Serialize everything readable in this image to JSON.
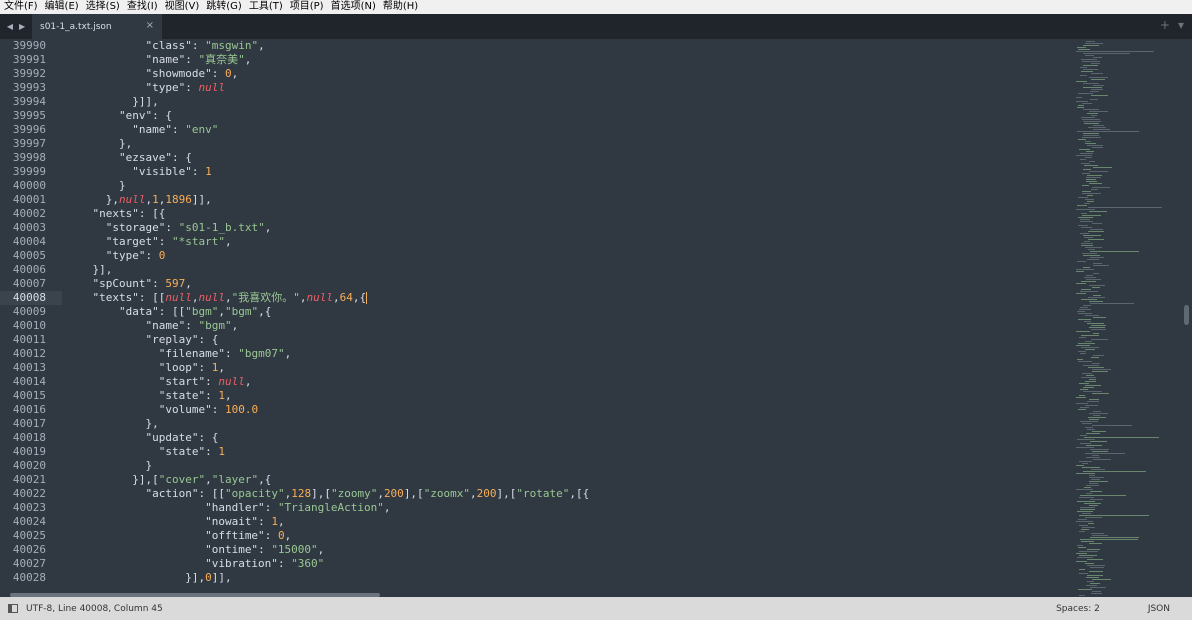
{
  "menu": [
    "文件(F)",
    "编辑(E)",
    "选择(S)",
    "查找(I)",
    "视图(V)",
    "跳转(G)",
    "工具(T)",
    "项目(P)",
    "首选项(N)",
    "帮助(H)"
  ],
  "tab": {
    "title": "s01-1_a.txt.json",
    "close": "×"
  },
  "tab_actions": {
    "add": "+",
    "menu": "▾"
  },
  "nav": {
    "back": "◀",
    "forward": "▶"
  },
  "editor": {
    "active_line": 40008,
    "lines": [
      {
        "n": "39990",
        "t": [
          [
            "p",
            "            "
          ],
          [
            "k",
            "\"class\""
          ],
          [
            "p",
            ": "
          ],
          [
            "s",
            "\"msgwin\""
          ],
          [
            "p",
            ","
          ]
        ]
      },
      {
        "n": "39991",
        "t": [
          [
            "p",
            "            "
          ],
          [
            "k",
            "\"name\""
          ],
          [
            "p",
            ": "
          ],
          [
            "s",
            "\"真奈美\""
          ],
          [
            "p",
            ","
          ]
        ]
      },
      {
        "n": "39992",
        "t": [
          [
            "p",
            "            "
          ],
          [
            "k",
            "\"showmode\""
          ],
          [
            "p",
            ": "
          ],
          [
            "n",
            "0"
          ],
          [
            "p",
            ","
          ]
        ]
      },
      {
        "n": "39993",
        "t": [
          [
            "p",
            "            "
          ],
          [
            "k",
            "\"type\""
          ],
          [
            "p",
            ": "
          ],
          [
            "nl",
            "null"
          ]
        ]
      },
      {
        "n": "39994",
        "t": [
          [
            "p",
            "          }]],"
          ]
        ]
      },
      {
        "n": "39995",
        "t": [
          [
            "p",
            "        "
          ],
          [
            "k",
            "\"env\""
          ],
          [
            "p",
            ": {"
          ]
        ]
      },
      {
        "n": "39996",
        "t": [
          [
            "p",
            "          "
          ],
          [
            "k",
            "\"name\""
          ],
          [
            "p",
            ": "
          ],
          [
            "s",
            "\"env\""
          ]
        ]
      },
      {
        "n": "39997",
        "t": [
          [
            "p",
            "        },"
          ]
        ]
      },
      {
        "n": "39998",
        "t": [
          [
            "p",
            "        "
          ],
          [
            "k",
            "\"ezsave\""
          ],
          [
            "p",
            ": {"
          ]
        ]
      },
      {
        "n": "39999",
        "t": [
          [
            "p",
            "          "
          ],
          [
            "k",
            "\"visible\""
          ],
          [
            "p",
            ": "
          ],
          [
            "n",
            "1"
          ]
        ]
      },
      {
        "n": "40000",
        "t": [
          [
            "p",
            "        }"
          ]
        ]
      },
      {
        "n": "40001",
        "t": [
          [
            "p",
            "      },"
          ],
          [
            "nl",
            "null"
          ],
          [
            "p",
            ","
          ],
          [
            "n",
            "1"
          ],
          [
            "p",
            ","
          ],
          [
            "n",
            "1896"
          ],
          [
            "p",
            "]],"
          ]
        ]
      },
      {
        "n": "40002",
        "t": [
          [
            "p",
            "    "
          ],
          [
            "k",
            "\"nexts\""
          ],
          [
            "p",
            ": [{"
          ]
        ]
      },
      {
        "n": "40003",
        "t": [
          [
            "p",
            "      "
          ],
          [
            "k",
            "\"storage\""
          ],
          [
            "p",
            ": "
          ],
          [
            "s",
            "\"s01-1_b.txt\""
          ],
          [
            "p",
            ","
          ]
        ]
      },
      {
        "n": "40004",
        "t": [
          [
            "p",
            "      "
          ],
          [
            "k",
            "\"target\""
          ],
          [
            "p",
            ": "
          ],
          [
            "s",
            "\"*start\""
          ],
          [
            "p",
            ","
          ]
        ]
      },
      {
        "n": "40005",
        "t": [
          [
            "p",
            "      "
          ],
          [
            "k",
            "\"type\""
          ],
          [
            "p",
            ": "
          ],
          [
            "n",
            "0"
          ]
        ]
      },
      {
        "n": "40006",
        "t": [
          [
            "p",
            "    }],"
          ]
        ]
      },
      {
        "n": "40007",
        "t": [
          [
            "p",
            "    "
          ],
          [
            "k",
            "\"spCount\""
          ],
          [
            "p",
            ": "
          ],
          [
            "n",
            "597"
          ],
          [
            "p",
            ","
          ]
        ]
      },
      {
        "n": "40008",
        "t": [
          [
            "p",
            "    "
          ],
          [
            "k",
            "\"texts\""
          ],
          [
            "p",
            ": [["
          ],
          [
            "nl",
            "null"
          ],
          [
            "p",
            ","
          ],
          [
            "nl",
            "null"
          ],
          [
            "p",
            ","
          ],
          [
            "s",
            "\"我喜欢你。\""
          ],
          [
            "p",
            ","
          ],
          [
            "nl",
            "null"
          ],
          [
            "p",
            ","
          ],
          [
            "n",
            "64"
          ],
          [
            "p",
            ",{"
          ]
        ],
        "cursor": true
      },
      {
        "n": "40009",
        "t": [
          [
            "p",
            "        "
          ],
          [
            "k",
            "\"data\""
          ],
          [
            "p",
            ": [["
          ],
          [
            "s",
            "\"bgm\""
          ],
          [
            "p",
            ","
          ],
          [
            "s",
            "\"bgm\""
          ],
          [
            "p",
            ",{"
          ]
        ]
      },
      {
        "n": "40010",
        "t": [
          [
            "p",
            "            "
          ],
          [
            "k",
            "\"name\""
          ],
          [
            "p",
            ": "
          ],
          [
            "s",
            "\"bgm\""
          ],
          [
            "p",
            ","
          ]
        ]
      },
      {
        "n": "40011",
        "t": [
          [
            "p",
            "            "
          ],
          [
            "k",
            "\"replay\""
          ],
          [
            "p",
            ": {"
          ]
        ]
      },
      {
        "n": "40012",
        "t": [
          [
            "p",
            "              "
          ],
          [
            "k",
            "\"filename\""
          ],
          [
            "p",
            ": "
          ],
          [
            "s",
            "\"bgm07\""
          ],
          [
            "p",
            ","
          ]
        ]
      },
      {
        "n": "40013",
        "t": [
          [
            "p",
            "              "
          ],
          [
            "k",
            "\"loop\""
          ],
          [
            "p",
            ": "
          ],
          [
            "n",
            "1"
          ],
          [
            "p",
            ","
          ]
        ]
      },
      {
        "n": "40014",
        "t": [
          [
            "p",
            "              "
          ],
          [
            "k",
            "\"start\""
          ],
          [
            "p",
            ": "
          ],
          [
            "nl",
            "null"
          ],
          [
            "p",
            ","
          ]
        ]
      },
      {
        "n": "40015",
        "t": [
          [
            "p",
            "              "
          ],
          [
            "k",
            "\"state\""
          ],
          [
            "p",
            ": "
          ],
          [
            "n",
            "1"
          ],
          [
            "p",
            ","
          ]
        ]
      },
      {
        "n": "40016",
        "t": [
          [
            "p",
            "              "
          ],
          [
            "k",
            "\"volume\""
          ],
          [
            "p",
            ": "
          ],
          [
            "n",
            "100.0"
          ]
        ]
      },
      {
        "n": "40017",
        "t": [
          [
            "p",
            "            },"
          ]
        ]
      },
      {
        "n": "40018",
        "t": [
          [
            "p",
            "            "
          ],
          [
            "k",
            "\"update\""
          ],
          [
            "p",
            ": {"
          ]
        ]
      },
      {
        "n": "40019",
        "t": [
          [
            "p",
            "              "
          ],
          [
            "k",
            "\"state\""
          ],
          [
            "p",
            ": "
          ],
          [
            "n",
            "1"
          ]
        ]
      },
      {
        "n": "40020",
        "t": [
          [
            "p",
            "            }"
          ]
        ]
      },
      {
        "n": "40021",
        "t": [
          [
            "p",
            "          }],["
          ],
          [
            "s",
            "\"cover\""
          ],
          [
            "p",
            ","
          ],
          [
            "s",
            "\"layer\""
          ],
          [
            "p",
            ",{"
          ]
        ]
      },
      {
        "n": "40022",
        "t": [
          [
            "p",
            "            "
          ],
          [
            "k",
            "\"action\""
          ],
          [
            "p",
            ": [["
          ],
          [
            "s",
            "\"opacity\""
          ],
          [
            "p",
            ","
          ],
          [
            "n",
            "128"
          ],
          [
            "p",
            "],["
          ],
          [
            "s",
            "\"zoomy\""
          ],
          [
            "p",
            ","
          ],
          [
            "n",
            "200"
          ],
          [
            "p",
            "],["
          ],
          [
            "s",
            "\"zoomx\""
          ],
          [
            "p",
            ","
          ],
          [
            "n",
            "200"
          ],
          [
            "p",
            "],["
          ],
          [
            "s",
            "\"rotate\""
          ],
          [
            "p",
            ",[{"
          ]
        ]
      },
      {
        "n": "40023",
        "t": [
          [
            "p",
            "                     "
          ],
          [
            "k",
            "\"handler\""
          ],
          [
            "p",
            ": "
          ],
          [
            "s",
            "\"TriangleAction\""
          ],
          [
            "p",
            ","
          ]
        ]
      },
      {
        "n": "40024",
        "t": [
          [
            "p",
            "                     "
          ],
          [
            "k",
            "\"nowait\""
          ],
          [
            "p",
            ": "
          ],
          [
            "n",
            "1"
          ],
          [
            "p",
            ","
          ]
        ]
      },
      {
        "n": "40025",
        "t": [
          [
            "p",
            "                     "
          ],
          [
            "k",
            "\"offtime\""
          ],
          [
            "p",
            ": "
          ],
          [
            "n",
            "0"
          ],
          [
            "p",
            ","
          ]
        ]
      },
      {
        "n": "40026",
        "t": [
          [
            "p",
            "                     "
          ],
          [
            "k",
            "\"ontime\""
          ],
          [
            "p",
            ": "
          ],
          [
            "s",
            "\"15000\""
          ],
          [
            "p",
            ","
          ]
        ]
      },
      {
        "n": "40027",
        "t": [
          [
            "p",
            "                     "
          ],
          [
            "k",
            "\"vibration\""
          ],
          [
            "p",
            ": "
          ],
          [
            "s",
            "\"360\""
          ]
        ]
      },
      {
        "n": "40028",
        "t": [
          [
            "p",
            "                  }],"
          ],
          [
            "n",
            "0"
          ],
          [
            "p",
            "]],"
          ]
        ]
      }
    ]
  },
  "status": {
    "position": "UTF-8, Line 40008, Column 45",
    "spaces": "Spaces: 2",
    "syntax": "JSON"
  },
  "colors": {
    "background": "#303841",
    "string": "#99c794",
    "number": "#f9ae58",
    "null": "#ec5f66",
    "text": "#d8dee9"
  }
}
